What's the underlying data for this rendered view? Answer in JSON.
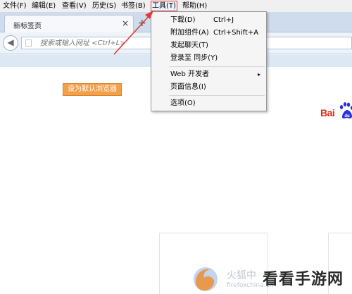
{
  "menubar": {
    "items": [
      {
        "label": "文件(F)"
      },
      {
        "label": "编辑(E)"
      },
      {
        "label": "查看(V)"
      },
      {
        "label": "历史(S)"
      },
      {
        "label": "书签(B)"
      },
      {
        "label": "工具(T)"
      },
      {
        "label": "帮助(H)"
      }
    ]
  },
  "tabs": {
    "active_title": "新标签页",
    "close_glyph": "×",
    "new_tab_glyph": "+"
  },
  "navbar": {
    "back_glyph": "◀",
    "url_placeholder": "搜索或输入网址 <Ctrl+L>"
  },
  "page": {
    "set_default_label": "设为默认浏览器",
    "baidu_logo_text": "Bai",
    "baidu_paw_text": "du"
  },
  "tools_menu": {
    "items": [
      {
        "label": "下载(D)",
        "shortcut": "Ctrl+J"
      },
      {
        "label": "附加组件(A)",
        "shortcut": "Ctrl+Shift+A"
      },
      {
        "label": "发起聊天(T)",
        "shortcut": ""
      },
      {
        "label": "登录至 同步(Y)",
        "shortcut": ""
      },
      {
        "label": "Web 开发者",
        "shortcut": "",
        "submenu": true
      },
      {
        "label": "页面信息(I)",
        "shortcut": ""
      },
      {
        "label": "选项(O)",
        "shortcut": ""
      }
    ],
    "submenu_arrow": "▸"
  },
  "watermark": {
    "fox_text": "火狐中",
    "url_text": "firefoxchina.cn",
    "site_text": "看看手游网"
  },
  "colors": {
    "annotation": "#e53935",
    "button_orange": "#f2a04a",
    "baidu_red": "#de2910",
    "baidu_blue": "#2932e1"
  }
}
